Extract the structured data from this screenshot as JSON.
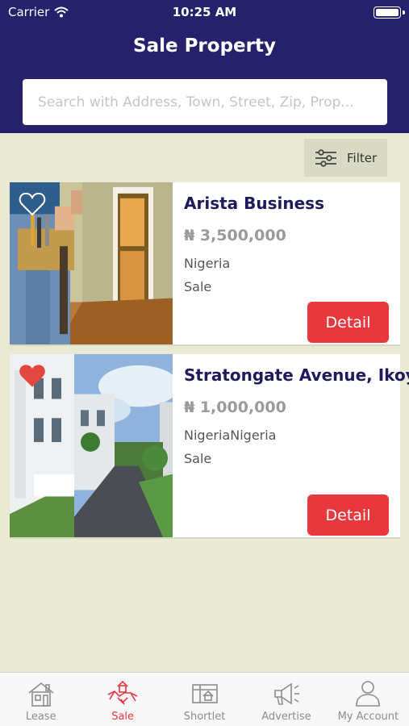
{
  "status_bar": {
    "carrier": "Carrier",
    "time": "10:25 AM"
  },
  "header": {
    "title": "Sale Property"
  },
  "search": {
    "placeholder": "Search with Address, Town, Street, Zip, Prop..."
  },
  "filter": {
    "label": "Filter",
    "icon": "sliders-icon"
  },
  "listings": [
    {
      "name": "Arista Business",
      "price": "₦ 3,500,000",
      "location": "Nigeria",
      "type": "Sale",
      "favorite": false,
      "detail_label": "Detail"
    },
    {
      "name": "Stratongate Avenue, Ikoyi",
      "price": "₦ 1,000,000",
      "location": "NigeriaNigeria",
      "type": "Sale",
      "favorite": true,
      "detail_label": "Detail"
    }
  ],
  "tabbar": {
    "active": "Sale",
    "items": [
      {
        "label": "Lease",
        "icon": "house-icon"
      },
      {
        "label": "Sale",
        "icon": "handshake-icon"
      },
      {
        "label": "Shortlet",
        "icon": "map-house-icon"
      },
      {
        "label": "Advertise",
        "icon": "megaphone-icon"
      },
      {
        "label": "My Account",
        "icon": "person-icon"
      }
    ]
  },
  "colors": {
    "header": "#27206b",
    "accent": "#e8383e",
    "background": "#e9e9d4",
    "title_text": "#1f1a5c"
  }
}
